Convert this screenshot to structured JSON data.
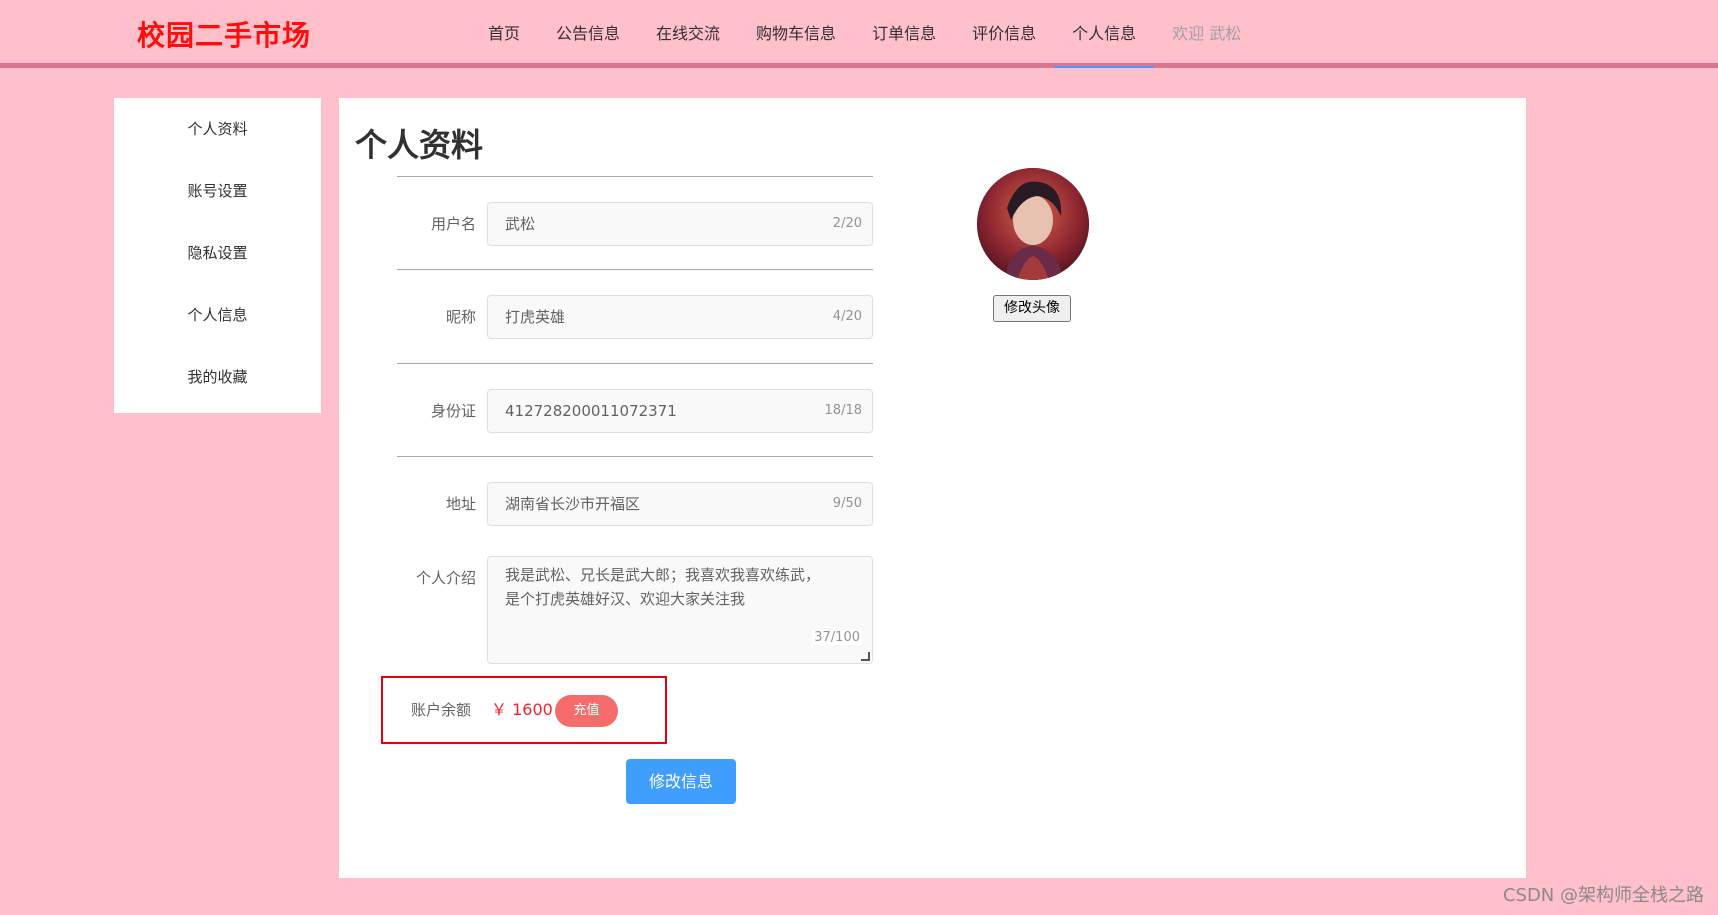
{
  "header": {
    "brand": "校园二手市场",
    "nav": [
      {
        "label": "首页"
      },
      {
        "label": "公告信息"
      },
      {
        "label": "在线交流"
      },
      {
        "label": "购物车信息"
      },
      {
        "label": "订单信息"
      },
      {
        "label": "评价信息"
      },
      {
        "label": "个人信息",
        "active": true
      }
    ],
    "welcome": "欢迎 武松"
  },
  "sidebar": {
    "items": [
      {
        "label": "个人资料"
      },
      {
        "label": "账号设置"
      },
      {
        "label": "隐私设置"
      },
      {
        "label": "个人信息"
      },
      {
        "label": "我的收藏"
      }
    ]
  },
  "main": {
    "title": "个人资料",
    "fields": {
      "username": {
        "label": "用户名",
        "value": "武松",
        "count": "2/20"
      },
      "nickname": {
        "label": "昵称",
        "value": "打虎英雄",
        "count": "4/20"
      },
      "idcard": {
        "label": "身份证",
        "value": "412728200011072371",
        "count": "18/18"
      },
      "address": {
        "label": "地址",
        "value": "湖南省长沙市开福区",
        "count": "9/50"
      },
      "intro": {
        "label": "个人介绍",
        "value": "我是武松、兄长是武大郎；我喜欢我喜欢练武，\n是个打虎英雄好汉、欢迎大家关注我",
        "count": "37/100"
      }
    },
    "balance": {
      "label": "账户余额",
      "value": "￥ 1600",
      "recharge_label": "充值"
    },
    "submit_label": "修改信息",
    "avatar_button_label": "修改头像"
  },
  "watermark": "CSDN @架构师全栈之路",
  "colors": {
    "page_bg": "#ffbfcb",
    "brand": "#ff0d0d",
    "primary": "#409eff",
    "danger": "#f56c6c",
    "highlight_border": "#e60012"
  }
}
